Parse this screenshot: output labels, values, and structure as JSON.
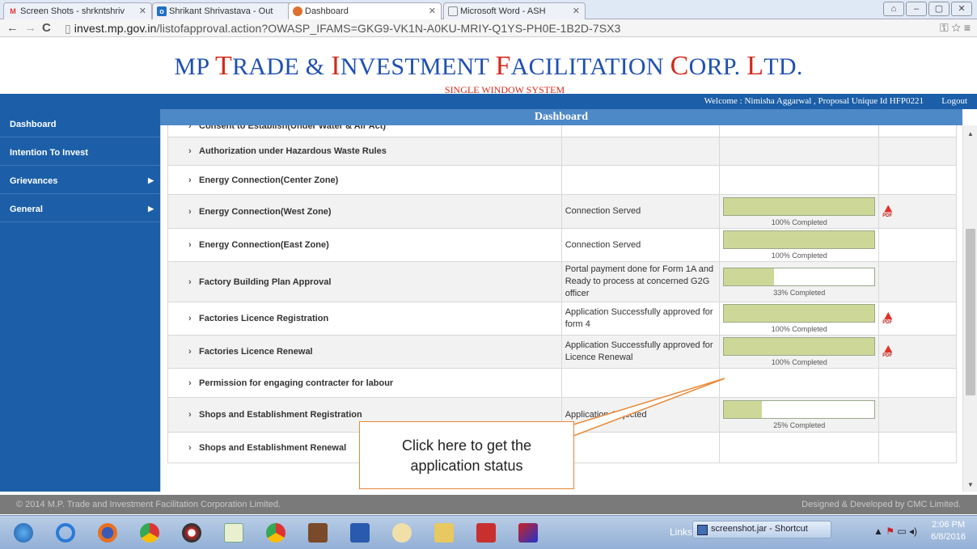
{
  "browser": {
    "tabs": [
      {
        "label": "Screen Shots - shrkntshriv",
        "icon": "gmail-icon"
      },
      {
        "label": "Shrikant Shrivastava - Out",
        "icon": "outlook-icon"
      },
      {
        "label": "Dashboard",
        "icon": "site-icon"
      },
      {
        "label": "Microsoft Word - ASH",
        "icon": "document-icon"
      }
    ],
    "url_host": "invest.mp.gov.in",
    "url_path": "/listofapproval.action?OWASP_IFAMS=GKG9-VK1N-A0KU-MRIY-Q1YS-PH0E-1B2D-7SX3"
  },
  "header": {
    "title_parts": [
      "MP ",
      "T",
      "RADE & ",
      "I",
      "NVESTMENT ",
      "F",
      "ACILITATION ",
      "C",
      "ORP. ",
      "L",
      "TD."
    ],
    "subtitle": "SINGLE WINDOW SYSTEM",
    "welcome": "Welcome : Nimisha Aggarwal , Proposal Unique Id HFP0221",
    "logout": "Logout"
  },
  "sidebar": {
    "items": [
      {
        "label": "Dashboard",
        "has_submenu": false
      },
      {
        "label": "Intention To Invest",
        "has_submenu": false
      },
      {
        "label": "Grievances",
        "has_submenu": true
      },
      {
        "label": "General",
        "has_submenu": true
      }
    ]
  },
  "dashboard": {
    "title": "Dashboard",
    "rows": [
      {
        "name": "Consent to Establish(Under Water & Air Act)",
        "status": "",
        "progress": null,
        "progress_label": "",
        "pdf": false
      },
      {
        "name": "Authorization under Hazardous Waste Rules",
        "status": "",
        "progress": null,
        "progress_label": "",
        "pdf": false
      },
      {
        "name": "Energy Connection(Center Zone)",
        "status": "",
        "progress": null,
        "progress_label": "",
        "pdf": false
      },
      {
        "name": "Energy Connection(West Zone)",
        "status": "Connection Served",
        "progress": 1.0,
        "progress_label": "100% Completed",
        "pdf": true
      },
      {
        "name": "Energy Connection(East Zone)",
        "status": "Connection Served",
        "progress": 1.0,
        "progress_label": "100% Completed",
        "pdf": false
      },
      {
        "name": "Factory Building Plan Approval",
        "status": "Portal payment done for Form 1A and Ready to process at concerned G2G officer",
        "progress": 0.33,
        "progress_label": "33% Completed",
        "pdf": false
      },
      {
        "name": "Factories Licence Registration",
        "status": "Application Successfully approved for form 4",
        "progress": 1.0,
        "progress_label": "100% Completed",
        "pdf": true
      },
      {
        "name": "Factories Licence Renewal",
        "status": "Application Successfully approved for Licence Renewal",
        "progress": 1.0,
        "progress_label": "100% Completed",
        "pdf": true
      },
      {
        "name": "Permission for engaging contracter for labour",
        "status": "",
        "progress": null,
        "progress_label": "",
        "pdf": false
      },
      {
        "name": "Shops and Establishment Registration",
        "status": "Application Objected",
        "progress": 0.25,
        "progress_label": "25% Completed",
        "pdf": false
      },
      {
        "name": "Shops and Establishment Renewal",
        "status": "",
        "progress": null,
        "progress_label": "",
        "pdf": false
      }
    ]
  },
  "footer": {
    "left": "© 2014 M.P. Trade and Investment Facilitation Corporation Limited.",
    "right": "Designed & Developed by CMC Limited."
  },
  "callout": {
    "line1": "Click here to get the",
    "line2": "application status"
  },
  "taskbar": {
    "links": "Links",
    "task_label": "screenshot.jar - Shortcut",
    "time": "2:06 PM",
    "date": "6/8/2016"
  },
  "colors": {
    "brand_blue": "#1c5fa8",
    "title_red": "#d42a1a",
    "progress_fill": "#cdd898",
    "callout_orange": "#e88838"
  }
}
